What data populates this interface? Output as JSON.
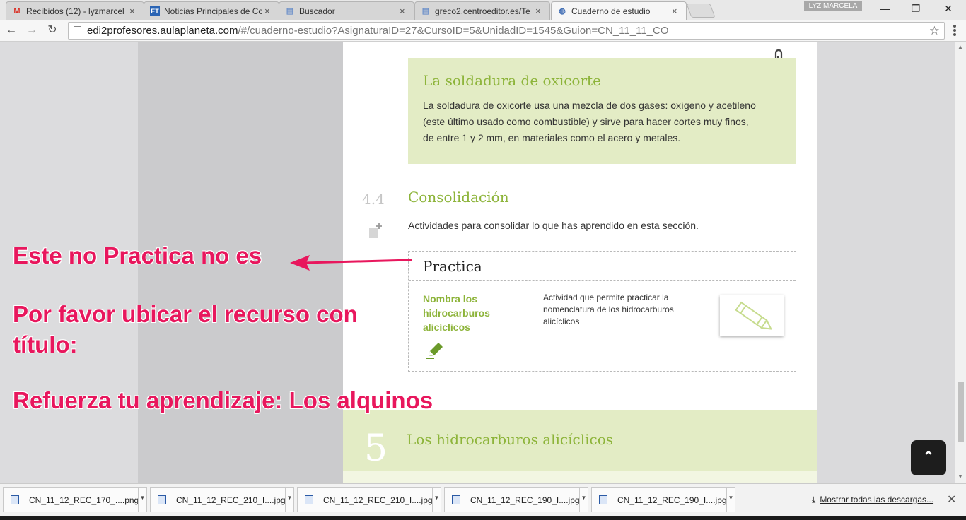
{
  "browser": {
    "tabs": [
      {
        "title": "Recibidos (12) - lyzmarcel",
        "icon": "gmail-icon",
        "icon_glyph": "M",
        "icon_color": "#d93025",
        "active": false
      },
      {
        "title": "Noticias Principales de Co",
        "icon": "et-news-icon",
        "icon_glyph": "ET",
        "icon_color": "#2a64b4",
        "active": false
      },
      {
        "title": "Buscador",
        "icon": "page-icon",
        "icon_glyph": "▤",
        "icon_color": "#6b8fc9",
        "active": false
      },
      {
        "title": "greco2.centroeditor.es/Te",
        "icon": "page-icon",
        "icon_glyph": "▤",
        "icon_color": "#6b8fc9",
        "active": false
      },
      {
        "title": "Cuaderno de estudio",
        "icon": "globe-icon",
        "icon_glyph": "◍",
        "icon_color": "#3d6bb3",
        "active": true
      }
    ],
    "tab_close": "×",
    "user_badge": "LYZ MARCELA",
    "window_controls": {
      "minimize": "—",
      "maximize": "❐",
      "close": "✕"
    },
    "nav": {
      "back": "←",
      "forward": "→",
      "reload": "↻"
    },
    "url_host": "edi2profesores.aulaplaneta.com",
    "url_path": "/#/cuaderno-estudio?AsignaturaID=27&CursoID=5&UnidadID=1545&Guion=CN_11_11_CO",
    "star": "☆"
  },
  "page": {
    "green_box": {
      "title": "La soldadura de oxicorte",
      "body": "La soldadura de oxicorte usa una mezcla de dos gases: oxígeno y acetileno (este último usado como combustible) y sirve para hacer cortes muy finos, de entre 1 y 2 mm, en materiales como el acero y metales."
    },
    "section": {
      "number": "4.4",
      "title": "Consolidación",
      "description": "Actividades para consolidar lo que has aprendido en esta sección."
    },
    "practice": {
      "header": "Practica",
      "resource_title": "Nombra los hidrocarburos alicíclicos",
      "resource_desc": "Actividad que permite practicar la nomenclatura de los hidrocarburos alicíclicos"
    },
    "next_section": {
      "number": "5",
      "title": "Los hidrocarburos alicíclicos"
    },
    "colors": {
      "accent_green": "#8db43a",
      "box_bg": "#e3ecc5",
      "annotation_pink": "#e8175d"
    }
  },
  "annotations": {
    "line1": "Este no Practica no es",
    "line2": "Por favor ubicar el recurso con",
    "line3": "título:",
    "line4": "Refuerza tu aprendizaje: Los alquinos"
  },
  "back_to_top": "⌃",
  "downloads": {
    "items": [
      {
        "name": "CN_11_12_REC_170_....png"
      },
      {
        "name": "CN_11_12_REC_210_I....jpg"
      },
      {
        "name": "CN_11_12_REC_210_I....jpg"
      },
      {
        "name": "CN_11_12_REC_190_I....jpg"
      },
      {
        "name": "CN_11_12_REC_190_I....jpg"
      }
    ],
    "show_all": "Mostrar todas las descargas...",
    "close": "✕"
  }
}
